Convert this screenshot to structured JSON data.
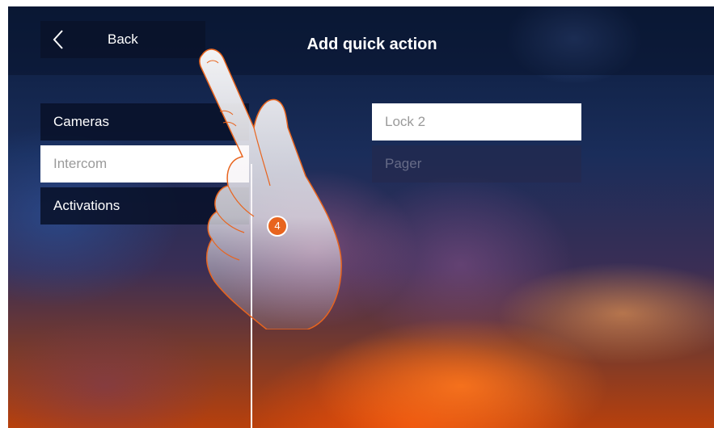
{
  "header": {
    "back_label": "Back",
    "title": "Add quick action"
  },
  "categories": [
    {
      "label": "Cameras",
      "selected": false
    },
    {
      "label": "Intercom",
      "selected": true
    },
    {
      "label": "Activations",
      "selected": false
    }
  ],
  "options": [
    {
      "label": "Lock 2",
      "enabled": true
    },
    {
      "label": "Pager",
      "enabled": false
    }
  ],
  "annotation": {
    "step": "4"
  },
  "colors": {
    "accent": "#e8641e",
    "panel": "#0a1228",
    "selected": "#ffffff"
  }
}
